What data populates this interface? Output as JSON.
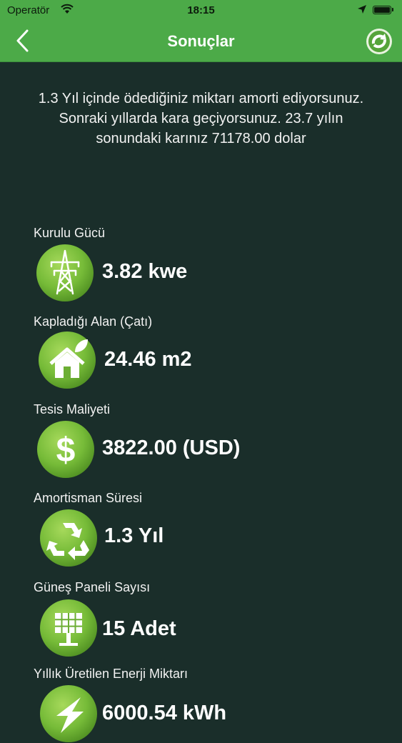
{
  "status_bar": {
    "carrier": "Operatör",
    "time": "18:15"
  },
  "nav": {
    "title": "Sonuçlar"
  },
  "summary": {
    "line1": "1.3 Yıl içinde ödediğiniz miktarı amorti ediyorsunuz.",
    "line2": "Sonraki yıllarda kara geçiyorsunuz. 23.7 yılın",
    "line3": "sonundaki karınız 71178.00 dolar"
  },
  "metrics": [
    {
      "label": "Kurulu Gücü",
      "value": "3.82 kwe",
      "icon": "power-tower-icon"
    },
    {
      "label": "Kapladığı Alan (Çatı)",
      "value": "24.46 m2",
      "icon": "eco-house-icon"
    },
    {
      "label": "Tesis Maliyeti",
      "value": "3822.00 (USD)",
      "icon": "dollar-icon"
    },
    {
      "label": "Amortisman Süresi",
      "value": "1.3 Yıl",
      "icon": "recycle-icon"
    },
    {
      "label": "Güneş Paneli Sayısı",
      "value": "15 Adet",
      "icon": "solar-panel-icon"
    },
    {
      "label": "Yıllık Üretilen Enerji Miktarı",
      "value": "6000.54 kWh",
      "icon": "lightning-icon"
    }
  ],
  "colors": {
    "brand_green": "#4caa48",
    "background": "#1a2e2a",
    "icon_green": "#7cc13e"
  }
}
